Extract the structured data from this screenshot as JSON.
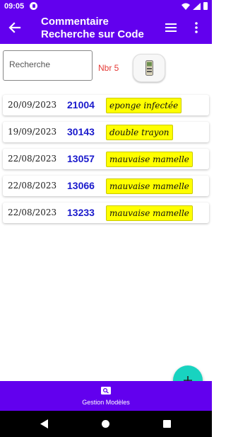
{
  "status_bar": {
    "time": "09:05"
  },
  "app_bar": {
    "title_line1": "Commentaire",
    "title_line2": "Recherche sur Code",
    "accent": "#6200ee"
  },
  "search": {
    "placeholder": "Recherche",
    "value": ""
  },
  "count_label": "Nbr 5",
  "list": {
    "items": [
      {
        "date": "20/09/2023",
        "code": "21004",
        "comment": "eponge infectée"
      },
      {
        "date": "19/09/2023",
        "code": "30143",
        "comment": "double trayon"
      },
      {
        "date": "22/08/2023",
        "code": "13057",
        "comment": "mauvaise mamelle"
      },
      {
        "date": "22/08/2023",
        "code": "13066",
        "comment": "mauvaise mamelle"
      },
      {
        "date": "22/08/2023",
        "code": "13233",
        "comment": "mauvaise mamelle"
      }
    ]
  },
  "fab": {
    "icon": "plus-icon",
    "color": "#18d3c0"
  },
  "bottom_nav": {
    "label": "Gestion Modèles",
    "icon": "search-box-icon"
  },
  "colors": {
    "code": "#1a1acc",
    "comment_highlight": "#ffff00",
    "count": "#e53935"
  }
}
